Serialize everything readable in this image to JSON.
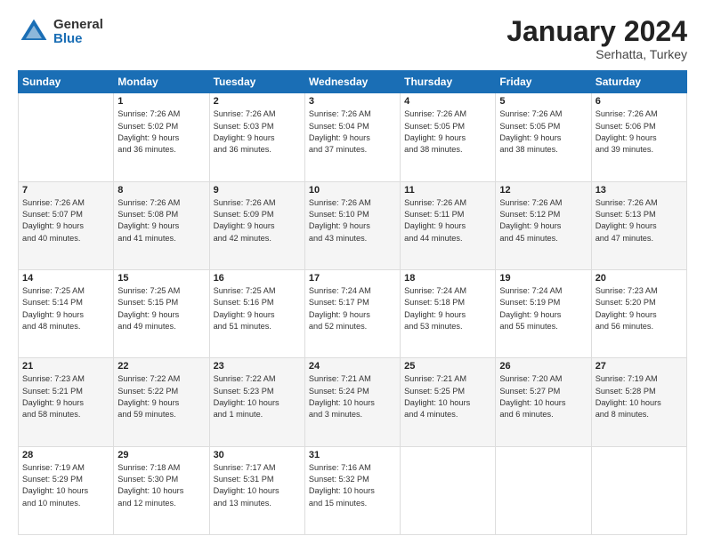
{
  "logo": {
    "general": "General",
    "blue": "Blue"
  },
  "title": "January 2024",
  "subtitle": "Serhatta, Turkey",
  "days_header": [
    "Sunday",
    "Monday",
    "Tuesday",
    "Wednesday",
    "Thursday",
    "Friday",
    "Saturday"
  ],
  "weeks": [
    [
      {
        "num": "",
        "info": ""
      },
      {
        "num": "1",
        "info": "Sunrise: 7:26 AM\nSunset: 5:02 PM\nDaylight: 9 hours\nand 36 minutes."
      },
      {
        "num": "2",
        "info": "Sunrise: 7:26 AM\nSunset: 5:03 PM\nDaylight: 9 hours\nand 36 minutes."
      },
      {
        "num": "3",
        "info": "Sunrise: 7:26 AM\nSunset: 5:04 PM\nDaylight: 9 hours\nand 37 minutes."
      },
      {
        "num": "4",
        "info": "Sunrise: 7:26 AM\nSunset: 5:05 PM\nDaylight: 9 hours\nand 38 minutes."
      },
      {
        "num": "5",
        "info": "Sunrise: 7:26 AM\nSunset: 5:05 PM\nDaylight: 9 hours\nand 38 minutes."
      },
      {
        "num": "6",
        "info": "Sunrise: 7:26 AM\nSunset: 5:06 PM\nDaylight: 9 hours\nand 39 minutes."
      }
    ],
    [
      {
        "num": "7",
        "info": "Sunrise: 7:26 AM\nSunset: 5:07 PM\nDaylight: 9 hours\nand 40 minutes."
      },
      {
        "num": "8",
        "info": "Sunrise: 7:26 AM\nSunset: 5:08 PM\nDaylight: 9 hours\nand 41 minutes."
      },
      {
        "num": "9",
        "info": "Sunrise: 7:26 AM\nSunset: 5:09 PM\nDaylight: 9 hours\nand 42 minutes."
      },
      {
        "num": "10",
        "info": "Sunrise: 7:26 AM\nSunset: 5:10 PM\nDaylight: 9 hours\nand 43 minutes."
      },
      {
        "num": "11",
        "info": "Sunrise: 7:26 AM\nSunset: 5:11 PM\nDaylight: 9 hours\nand 44 minutes."
      },
      {
        "num": "12",
        "info": "Sunrise: 7:26 AM\nSunset: 5:12 PM\nDaylight: 9 hours\nand 45 minutes."
      },
      {
        "num": "13",
        "info": "Sunrise: 7:26 AM\nSunset: 5:13 PM\nDaylight: 9 hours\nand 47 minutes."
      }
    ],
    [
      {
        "num": "14",
        "info": "Sunrise: 7:25 AM\nSunset: 5:14 PM\nDaylight: 9 hours\nand 48 minutes."
      },
      {
        "num": "15",
        "info": "Sunrise: 7:25 AM\nSunset: 5:15 PM\nDaylight: 9 hours\nand 49 minutes."
      },
      {
        "num": "16",
        "info": "Sunrise: 7:25 AM\nSunset: 5:16 PM\nDaylight: 9 hours\nand 51 minutes."
      },
      {
        "num": "17",
        "info": "Sunrise: 7:24 AM\nSunset: 5:17 PM\nDaylight: 9 hours\nand 52 minutes."
      },
      {
        "num": "18",
        "info": "Sunrise: 7:24 AM\nSunset: 5:18 PM\nDaylight: 9 hours\nand 53 minutes."
      },
      {
        "num": "19",
        "info": "Sunrise: 7:24 AM\nSunset: 5:19 PM\nDaylight: 9 hours\nand 55 minutes."
      },
      {
        "num": "20",
        "info": "Sunrise: 7:23 AM\nSunset: 5:20 PM\nDaylight: 9 hours\nand 56 minutes."
      }
    ],
    [
      {
        "num": "21",
        "info": "Sunrise: 7:23 AM\nSunset: 5:21 PM\nDaylight: 9 hours\nand 58 minutes."
      },
      {
        "num": "22",
        "info": "Sunrise: 7:22 AM\nSunset: 5:22 PM\nDaylight: 9 hours\nand 59 minutes."
      },
      {
        "num": "23",
        "info": "Sunrise: 7:22 AM\nSunset: 5:23 PM\nDaylight: 10 hours\nand 1 minute."
      },
      {
        "num": "24",
        "info": "Sunrise: 7:21 AM\nSunset: 5:24 PM\nDaylight: 10 hours\nand 3 minutes."
      },
      {
        "num": "25",
        "info": "Sunrise: 7:21 AM\nSunset: 5:25 PM\nDaylight: 10 hours\nand 4 minutes."
      },
      {
        "num": "26",
        "info": "Sunrise: 7:20 AM\nSunset: 5:27 PM\nDaylight: 10 hours\nand 6 minutes."
      },
      {
        "num": "27",
        "info": "Sunrise: 7:19 AM\nSunset: 5:28 PM\nDaylight: 10 hours\nand 8 minutes."
      }
    ],
    [
      {
        "num": "28",
        "info": "Sunrise: 7:19 AM\nSunset: 5:29 PM\nDaylight: 10 hours\nand 10 minutes."
      },
      {
        "num": "29",
        "info": "Sunrise: 7:18 AM\nSunset: 5:30 PM\nDaylight: 10 hours\nand 12 minutes."
      },
      {
        "num": "30",
        "info": "Sunrise: 7:17 AM\nSunset: 5:31 PM\nDaylight: 10 hours\nand 13 minutes."
      },
      {
        "num": "31",
        "info": "Sunrise: 7:16 AM\nSunset: 5:32 PM\nDaylight: 10 hours\nand 15 minutes."
      },
      {
        "num": "",
        "info": ""
      },
      {
        "num": "",
        "info": ""
      },
      {
        "num": "",
        "info": ""
      }
    ]
  ]
}
